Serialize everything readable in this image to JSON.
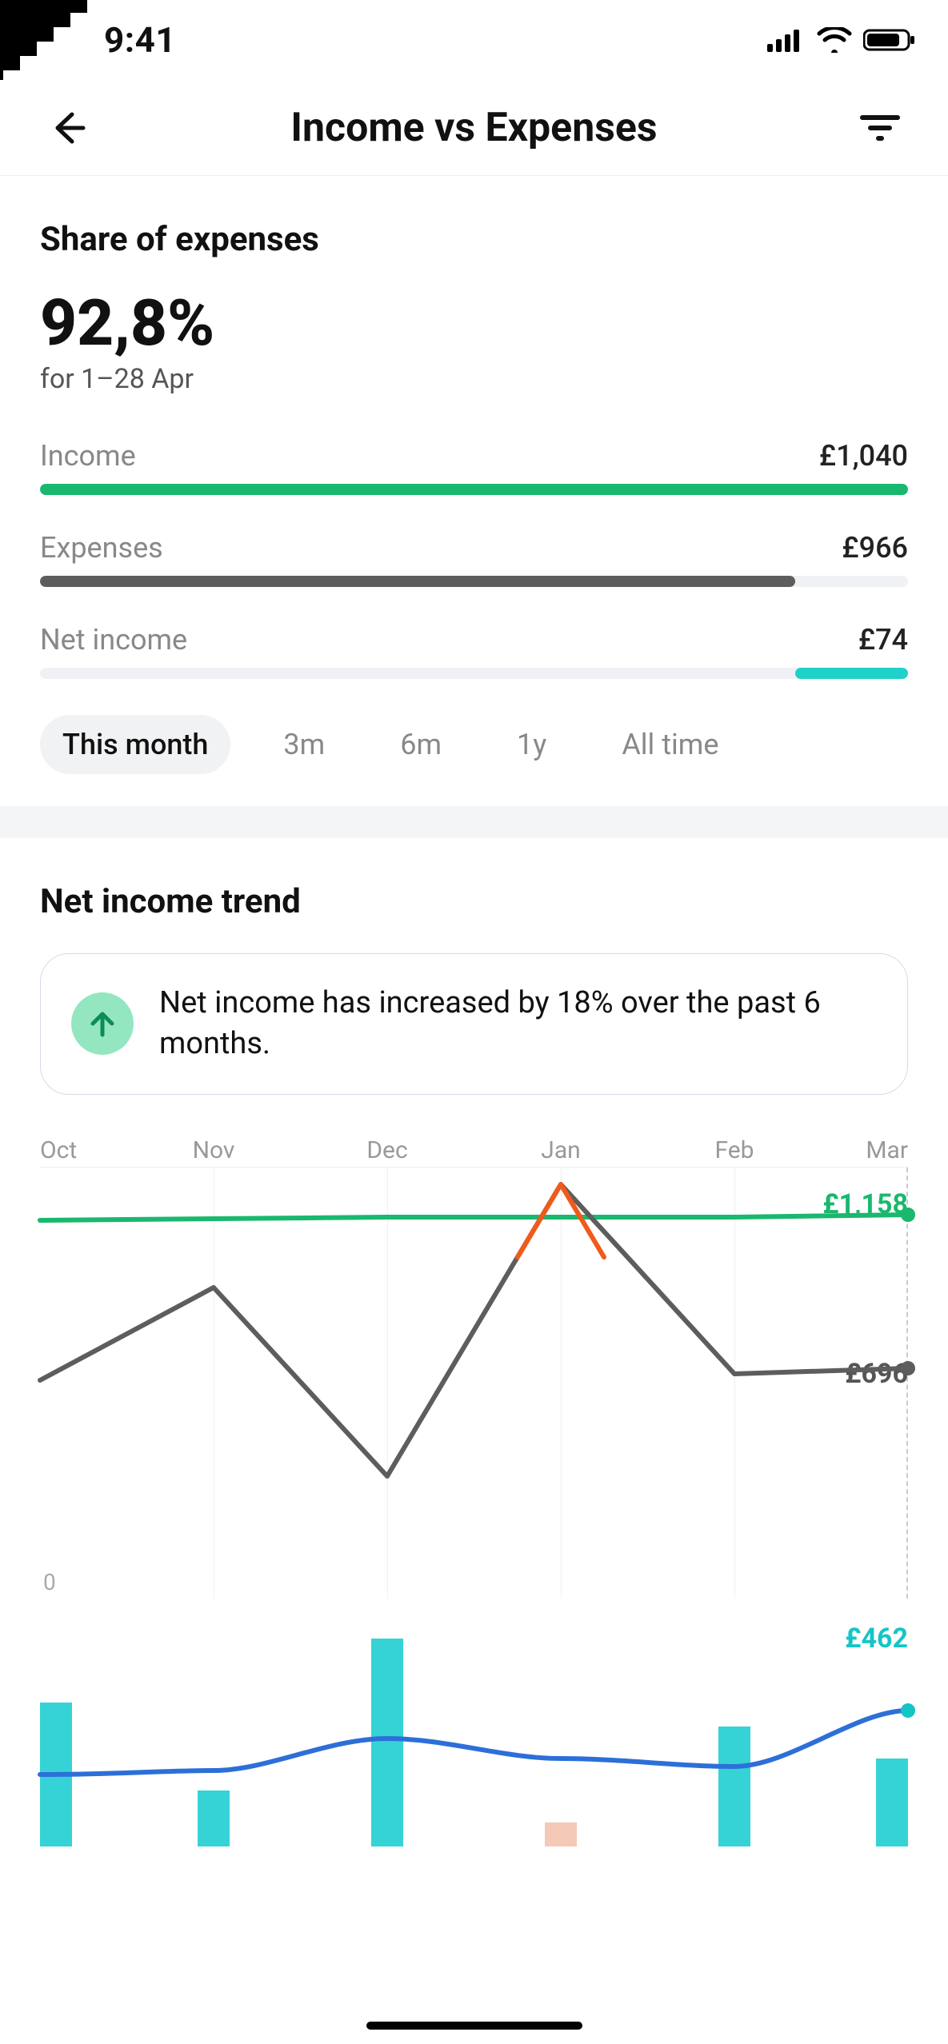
{
  "status": {
    "time": "9:41"
  },
  "header": {
    "title": "Income vs Expenses"
  },
  "share": {
    "title": "Share of expenses",
    "percent": "92,8%",
    "date_range": "for 1–28 Apr",
    "income_label": "Income",
    "income_value": "£1,040",
    "expenses_label": "Expenses",
    "expenses_value": "£966",
    "net_label": "Net income",
    "net_value": "£74"
  },
  "periods": {
    "this_month": "This month",
    "p3m": "3m",
    "p6m": "6m",
    "p1y": "1y",
    "all": "All time"
  },
  "trend": {
    "title": "Net income trend",
    "card_text": "Net income has increased by 18% over the past 6 months.",
    "income_end_label": "£1,158",
    "expense_end_label": "£696",
    "ylabel_zero": "0",
    "xlabels": {
      "oct": "Oct",
      "nov": "Nov",
      "dec": "Dec",
      "jan": "Jan",
      "feb": "Feb",
      "mar": "Mar"
    }
  },
  "chart2": {
    "end_label": "£462"
  },
  "chart_data": [
    {
      "type": "bar",
      "title": "Share of expenses bars",
      "series": [
        {
          "name": "Income",
          "values": [
            1040
          ],
          "fraction": 1.0,
          "color": "#19b86e"
        },
        {
          "name": "Expenses",
          "values": [
            966
          ],
          "fraction": 0.87,
          "color": "#5d5d5d"
        },
        {
          "name": "Net income",
          "values": [
            74
          ],
          "fraction": 0.13,
          "color": "#1fd1c9",
          "align": "right"
        }
      ],
      "currency": "£"
    },
    {
      "type": "line",
      "title": "Net income trend",
      "categories": [
        "Oct",
        "Nov",
        "Dec",
        "Jan",
        "Feb",
        "Mar"
      ],
      "series": [
        {
          "name": "Income",
          "color": "#19b86e",
          "values": [
            1140,
            1145,
            1150,
            1150,
            1150,
            1158
          ]
        },
        {
          "name": "Expenses",
          "color": "#5d5d5d",
          "values": [
            660,
            940,
            370,
            1250,
            680,
            696
          ],
          "peak_color": "#f05a1a",
          "peak_index": 3
        }
      ],
      "ylim": [
        0,
        1300
      ],
      "end_labels": {
        "Income": "£1,158",
        "Expenses": "£696"
      }
    },
    {
      "type": "bar",
      "title": "Bottom bar chart (partial view)",
      "categories": [
        "Oct",
        "Nov",
        "Dec",
        "Jan",
        "Feb",
        "Mar"
      ],
      "values": [
        180,
        70,
        260,
        30,
        150,
        110
      ],
      "overlay_line": {
        "color": "#2d6fd8",
        "values": [
          90,
          95,
          135,
          110,
          100,
          170
        ]
      },
      "ylim_hint": [
        0,
        280
      ],
      "bar_color": "#35d3d6",
      "end_label": "£462"
    }
  ]
}
